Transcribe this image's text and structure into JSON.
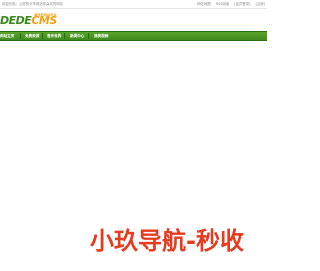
{
  "topbar": {
    "welcome": "欢迎光临：心愿的分享网站你喜欢的网站",
    "links": [
      "网站地图",
      "RSS阅读",
      "[会员登录]",
      "[注册]"
    ]
  },
  "logo": {
    "part1": "DEDE",
    "part2": "CMS",
    "tagline": "最佳的网站平台"
  },
  "nav": {
    "items": [
      "网站主页",
      "免费资源",
      "音乐世界",
      "新闻中心",
      "搞笑视频"
    ]
  },
  "slogan": "小玖导航-秒收",
  "colors": {
    "nav_green": "#4a9a24",
    "logo_green": "#3a8b1f",
    "logo_orange": "#f3a118",
    "slogan_red": "#e53b1f"
  }
}
